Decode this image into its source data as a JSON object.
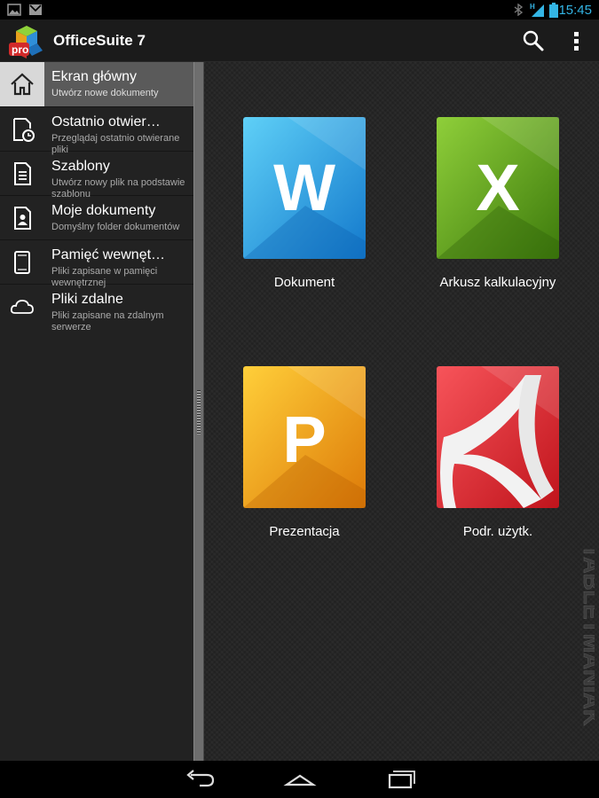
{
  "status_bar": {
    "time": "15:45",
    "icons": [
      "image-notification-icon",
      "gmail-notification-icon",
      "bluetooth-icon",
      "signal-icon",
      "battery-icon"
    ]
  },
  "app_bar": {
    "title": "OfficeSuite 7",
    "logo_badge": "pro",
    "actions": [
      "search-icon",
      "overflow-menu-icon"
    ]
  },
  "sidebar": {
    "items": [
      {
        "title": "Ekran główny",
        "subtitle": "Utwórz nowe dokumenty",
        "icon": "home-icon",
        "active": true
      },
      {
        "title": "Ostatnio otwier…",
        "subtitle": "Przeglądaj ostatnio otwierane pliki",
        "icon": "recent-files-icon",
        "active": false
      },
      {
        "title": "Szablony",
        "subtitle": "Utwórz nowy plik na podstawie szablonu",
        "icon": "template-icon",
        "active": false
      },
      {
        "title": "Moje dokumenty",
        "subtitle": "Domyślny folder dokumentów",
        "icon": "my-documents-icon",
        "active": false
      },
      {
        "title": "Pamięć wewnęt…",
        "subtitle": "Pliki zapisane w pamięci wewnętrznej",
        "icon": "tablet-icon",
        "active": false
      },
      {
        "title": "Pliki zdalne",
        "subtitle": "Pliki zapisane na zdalnym serwerze",
        "icon": "cloud-icon",
        "active": false
      }
    ]
  },
  "tiles": [
    {
      "label": "Dokument",
      "letter": "W",
      "icon": "word-document-icon",
      "color": "#2aa8e8"
    },
    {
      "label": "Arkusz kalkulacyjny",
      "letter": "X",
      "icon": "spreadsheet-icon",
      "color": "#5f9e17"
    },
    {
      "label": "Prezentacja",
      "letter": "P",
      "icon": "presentation-icon",
      "color": "#f0a020"
    },
    {
      "label": "Podr. użytk.",
      "letter": "",
      "icon": "pdf-manual-icon",
      "color": "#e3282d"
    }
  ],
  "watermark": {
    "text": "TABLETMANIAK"
  },
  "nav_bar": {
    "buttons": [
      "back-icon",
      "home-nav-icon",
      "recent-apps-icon"
    ]
  }
}
